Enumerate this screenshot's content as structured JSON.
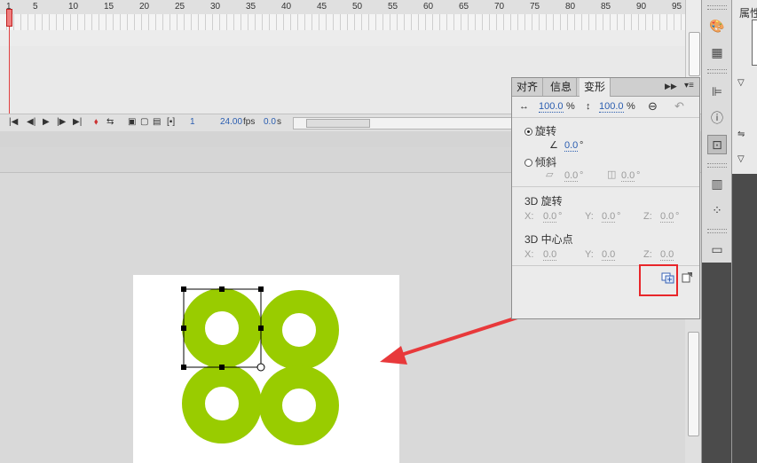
{
  "timeline": {
    "frame_numbers": [
      "1",
      "5",
      "10",
      "15",
      "20",
      "25",
      "30",
      "35",
      "40",
      "45",
      "50",
      "55",
      "60",
      "65",
      "70",
      "75",
      "80",
      "85",
      "90",
      "95"
    ],
    "current_frame": "1",
    "fps": "24.00",
    "fps_unit": "fps",
    "time": "0.0",
    "time_unit": "s"
  },
  "panel": {
    "tabs": [
      {
        "label": "对齐"
      },
      {
        "label": "信息"
      },
      {
        "label": "变形"
      }
    ],
    "scale_w": "100.0",
    "scale_h": "100.0",
    "percent": "%",
    "rotate_label": "旋转",
    "rotate_value": "0.0",
    "skew_label": "倾斜",
    "skew_h": "0.0",
    "skew_v": "0.0",
    "rot3d_label": "3D 旋转",
    "rot3d": {
      "x": "0.0",
      "y": "0.0",
      "z": "0.0"
    },
    "center3d_label": "3D 中心点",
    "center3d": {
      "x": "0.0",
      "y": "0.0",
      "z": "0.0"
    },
    "axis_x": "X:",
    "axis_y": "Y:",
    "axis_z": "Z:",
    "deg": "°"
  },
  "props_title": "属性",
  "colors": {
    "shape_green": "#99cc00",
    "highlight_red": "#e8262a",
    "arrow_red": "#e8393b"
  }
}
